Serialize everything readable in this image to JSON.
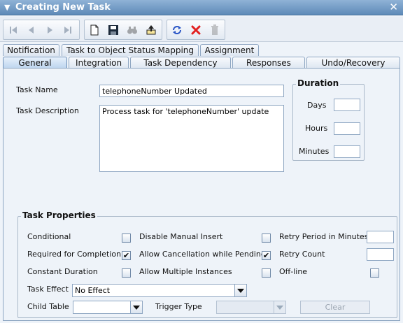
{
  "window": {
    "title": "Creating New Task"
  },
  "icons": {
    "collapse": "triangle-down-icon",
    "close": "close-icon",
    "toolbar": [
      "first-record-icon",
      "previous-record-icon",
      "next-record-icon",
      "last-record-icon",
      "new-document-icon",
      "save-icon",
      "find-binoculars-icon",
      "upload-tray-icon",
      "refresh-icon",
      "delete-x-icon",
      "trash-icon"
    ]
  },
  "colors": {
    "title_bar": "#5e8ab8",
    "delete_accent": "#e21f1f",
    "refresh_accent": "#2a56c6"
  },
  "tabs": {
    "row1": [
      "Notification",
      "Task to Object Status Mapping",
      "Assignment"
    ],
    "row2": [
      "General",
      "Integration",
      "Task Dependency",
      "Responses",
      "Undo/Recovery"
    ],
    "active": "General"
  },
  "general": {
    "task_name_label": "Task Name",
    "task_name_value": "telephoneNumber Updated",
    "task_description_label": "Task Description",
    "task_description_value": "Process task for 'telephoneNumber' update"
  },
  "duration": {
    "title": "Duration",
    "days_label": "Days",
    "days_value": "",
    "hours_label": "Hours",
    "hours_value": "",
    "minutes_label": "Minutes",
    "minutes_value": ""
  },
  "properties": {
    "title": "Task Properties",
    "conditional_label": "Conditional",
    "conditional_checked": false,
    "required_label": "Required for Completion",
    "required_checked": true,
    "constant_label": "Constant Duration",
    "constant_checked": false,
    "disable_manual_label": "Disable Manual Insert",
    "disable_manual_checked": false,
    "allow_cancel_label": "Allow Cancellation while Pending",
    "allow_cancel_checked": true,
    "allow_multiple_label": "Allow Multiple Instances",
    "allow_multiple_checked": false,
    "retry_period_label": "Retry Period in Minutes",
    "retry_period_value": "",
    "retry_count_label": "Retry Count",
    "retry_count_value": "",
    "offline_label": "Off-line",
    "offline_checked": false,
    "task_effect_label": "Task Effect",
    "task_effect_value": "No Effect",
    "child_table_label": "Child Table",
    "child_table_value": "",
    "trigger_type_label": "Trigger Type",
    "trigger_type_value": "",
    "clear_label": "Clear",
    "check_mark": "✔"
  }
}
